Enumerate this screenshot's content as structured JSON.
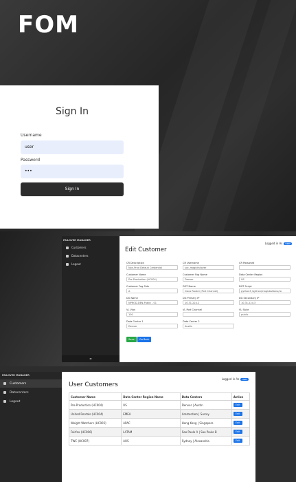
{
  "logo": "FOM",
  "signin": {
    "title": "Sign In",
    "username_label": "Username",
    "username_value": "user",
    "password_label": "Password",
    "password_value": "•••",
    "button_label": "Sign In"
  },
  "edit_customer": {
    "sidebar": {
      "brand": "FAILOVER MANAGER",
      "items": [
        {
          "label": "Customers"
        },
        {
          "label": "Datacenters"
        },
        {
          "label": "Logout"
        }
      ],
      "footer": "◂▸"
    },
    "logged_in_label": "Logged in As",
    "logged_in_user": "user",
    "title": "Edit Customer",
    "fields": [
      {
        "label": "CR Description",
        "value": "Non-Prod Default Credential"
      },
      {
        "label": "CR Username",
        "value": "svc_magicfailover"
      },
      {
        "label": "CR Password",
        "value": ""
      },
      {
        "label": "Customer Name",
        "value": "Pre-Production (HC004)"
      },
      {
        "label": "Customer Fog Name",
        "value": "Denver"
      },
      {
        "label": "Data Center Region",
        "value": "US"
      },
      {
        "label": "Customer Fog Side",
        "value": "A"
      },
      {
        "label": "DGT Name",
        "value": "Cisco Router (Port Channel)"
      },
      {
        "label": "DGT Script",
        "value": "python3 /python/magicbuttons/ro"
      },
      {
        "label": "DG Name",
        "value": "NPROD-DEN-Public - 01"
      },
      {
        "label": "DG Primary IP",
        "value": "10.31.224.2"
      },
      {
        "label": "DG Secondary IP",
        "value": "10.31.224.3"
      },
      {
        "label": "VL Vlan",
        "value": "100"
      },
      {
        "label": "VL Port Channel",
        "value": ""
      },
      {
        "label": "VL Style",
        "value": "public"
      },
      {
        "label": "Data Center 1",
        "value": "Denver"
      },
      {
        "label": "Data Center 2",
        "value": "Austin"
      }
    ],
    "save_label": "Save",
    "back_label": "Go Back"
  },
  "user_customers": {
    "sidebar": {
      "brand": "FAILOVER MANAGER",
      "items": [
        {
          "label": "Customers"
        },
        {
          "label": "Datacenters"
        },
        {
          "label": "Logout"
        }
      ]
    },
    "logged_in_label": "Logged in As",
    "logged_in_user": "user",
    "title": "User Customers",
    "columns": [
      "Customer Name",
      "Data Center Region Name",
      "Data Centers",
      "Action"
    ],
    "rows": [
      {
        "name": "Pre-Production (HC004)",
        "region": "US",
        "centers": "Denver | Austin",
        "action": "Edit"
      },
      {
        "name": "United Rentals (HC004)",
        "region": "EMEA",
        "centers": "Amsterdam | Surrey",
        "action": "Edit"
      },
      {
        "name": "Weight Watchers (HC005)",
        "region": "APAC",
        "centers": "Hong Kong | Singapore",
        "action": "Edit"
      },
      {
        "name": "Fairfax (HC006)",
        "region": "LATAM",
        "centers": "Sao Paulo A | Sao Paulo B",
        "action": "Edit"
      },
      {
        "name": "TWC (HC007)",
        "region": "AUS",
        "centers": "Sydney | Alexandria",
        "action": "Edit"
      }
    ]
  }
}
